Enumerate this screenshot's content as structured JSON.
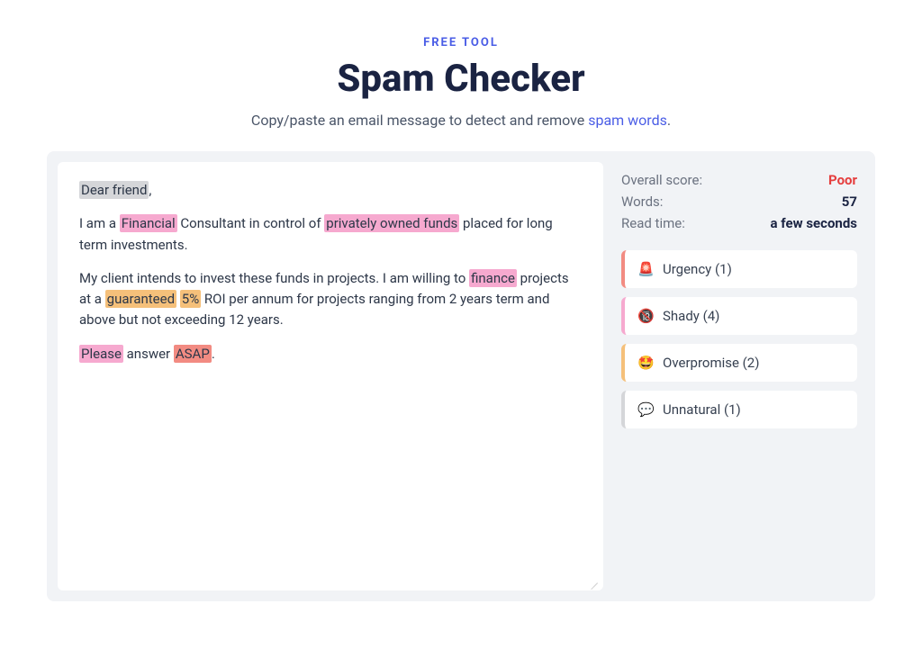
{
  "header": {
    "free_tool": "FREE TOOL",
    "title": "Spam Checker",
    "subtitle_pre": "Copy/paste an email message to detect and remove ",
    "subtitle_link": "spam words",
    "subtitle_post": "."
  },
  "content": {
    "p1_seg1": "Dear friend",
    "p1_seg2": ",",
    "p2_seg1": " I am a ",
    "p2_seg2": "Financial",
    "p2_seg3": " Consultant in control of ",
    "p2_seg4": "privately owned funds",
    "p2_seg5": " placed for long term investments.",
    "p3_seg1": " My client intends to invest these funds in projects. I am willing to ",
    "p3_seg2": "finance",
    "p3_seg3": " projects at a ",
    "p3_seg4": "guaranteed",
    "p3_seg5": " ",
    "p3_seg6": "5%",
    "p3_seg7": " ROI per annum for projects ranging from 2 years term and above but not exceeding 12 years.",
    "p4_seg1": " ",
    "p4_seg2": "Please",
    "p4_seg3": " answer ",
    "p4_seg4": "ASAP",
    "p4_seg5": "."
  },
  "stats": {
    "overall_label": "Overall score:",
    "overall_value": "Poor",
    "words_label": "Words:",
    "words_value": "57",
    "readtime_label": "Read time:",
    "readtime_value": "a few seconds"
  },
  "categories": [
    {
      "icon": "🚨",
      "label": "Urgency (1)"
    },
    {
      "icon": "🔞",
      "label": "Shady (4)"
    },
    {
      "icon": "🤩",
      "label": "Overpromise (2)"
    },
    {
      "icon": "💬",
      "label": "Unnatural (1)"
    }
  ]
}
